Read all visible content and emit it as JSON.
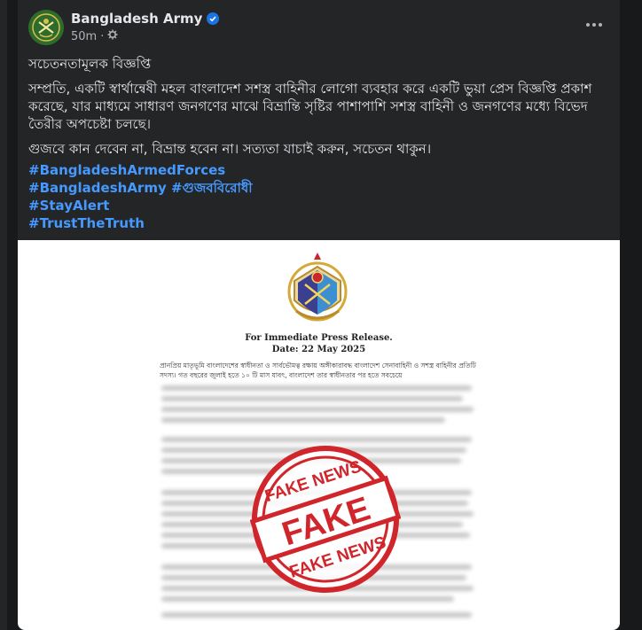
{
  "post": {
    "author": "Bangladesh Army",
    "time": "50m",
    "paragraphs": [
      "সচেতনতামূলক বিজ্ঞপ্তি",
      "সম্প্রতি, একটি স্বার্থান্বেষী মহল বাংলাদেশ সশস্ত্র বাহিনীর লোগো ব্যবহার করে একটি ভুয়া প্রেস বিজ্ঞপ্তি প্রকাশ করেছে, যার মাধ্যমে সাধারণ জনগণের মাঝে বিভ্রান্তি সৃষ্টির পাশাপাশি সশস্ত্র বাহিনী ও জনগণের মধ্যে বিভেদ তৈরীর অপচেষ্টা চলছে।",
      "গুজবে কান দেবেন না, বিভ্রান্ত হবেন না। সত্যতা যাচাই করুন, সচেতন থাকুন।"
    ],
    "hashtags": [
      "#BangladeshArmedForces",
      "#BangladeshArmy #গুজববিরোধী",
      "#StayAlert",
      "#TrustTheTruth"
    ]
  },
  "press_release": {
    "heading": "For Immediate Press Release.",
    "date": "Date: 22 May 2025",
    "first_lines": "প্রানপ্রিয় মাতৃভূমি বাংলাদেশের স্বাধীনতা ও সার্বভৌমত্ব রক্ষায় অঙ্গীকারাবদ্ধ বাংলাদেশ সেনাবাহিনী ও সশস্ত্র বাহিনীর প্রতিটি সদস্য। গত বছরের জুলাই হতে ১০ টি মাস যাবৎ, বাংলাদেশ তার স্বাধীনতার পর হতে সবচেয়ে",
    "stamp_top": "FAKE NEWS",
    "stamp_center": "FAKE",
    "stamp_bottom": "FAKE NEWS"
  },
  "colors": {
    "background": "#18191a",
    "card": "#242526",
    "text": "#e4e6eb",
    "secondary": "#b0b3b8",
    "link": "#4599ff",
    "verified": "#1b74e4",
    "stamp": "#d0252b"
  },
  "icons": [
    "army-logo-icon",
    "verified-badge-icon",
    "globe-settings-icon",
    "more-options-icon",
    "tri-service-emblem-icon",
    "fake-news-stamp-icon"
  ]
}
